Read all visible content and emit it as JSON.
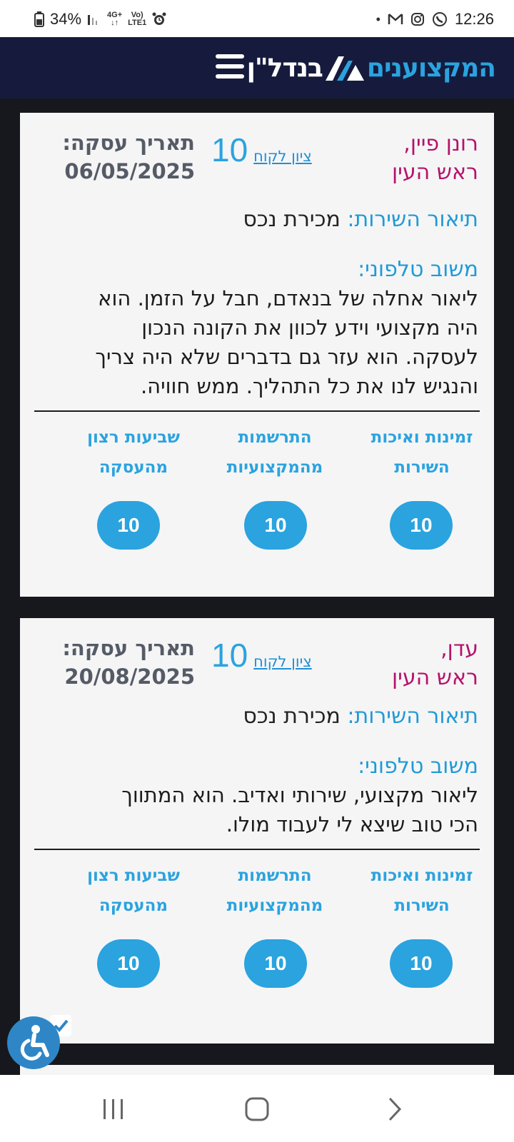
{
  "status_bar": {
    "battery": "34%",
    "network_top": "4G+",
    "volte_top": "Vo)",
    "volte_bottom": "LTE1",
    "time": "12:26"
  },
  "header": {
    "logo_word1": "המקצוענים",
    "logo_word2": "בנדל\"ן",
    "menu_icon": "hamburger-menu-icon",
    "brand_color": "#2aa3df",
    "header_bg": "#161b3d"
  },
  "common": {
    "score_label": "ציון לקוח",
    "date_label": "תאריך עסקה:",
    "service_label": "תיאור השירות:",
    "phone_label": "משוב טלפוני:",
    "cat1": "זמינות ואיכות השירות",
    "cat2": "התרשמות מהמקצועיות",
    "cat3": "שביעות רצון מהעסקה"
  },
  "reviews": [
    {
      "name_line1": "רונן פיין,",
      "name_line2": "ראש העין",
      "score": "10",
      "date": "06/05/2025",
      "service": "מכירת נכס",
      "review_lines": [
        "ליאור אחלה של בנאדם, חבל על הזמן. הוא",
        "היה מקצועי וידע לכוון את הקונה הנכון",
        "לעסקה. הוא עזר גם בדברים שלא היה צריך",
        "והנגיש לנו את כל התהליך. ממש חוויה."
      ],
      "cat1_score": "10",
      "cat2_score": "10",
      "cat3_score": "10"
    },
    {
      "name_line1": "עדן,",
      "name_line2": "ראש העין",
      "score": "10",
      "date": "20/08/2025",
      "service": "מכירת נכס",
      "review_lines": [
        "ליאור מקצועי, שירותי ואדיב. הוא המתווך",
        "הכי טוב שיצא לי לעבוד מולו."
      ],
      "cat1_score": "10",
      "cat2_score": "10",
      "cat3_score": "10"
    }
  ],
  "colors": {
    "name": "#b5126a",
    "accent": "#2aa3df",
    "card_bg": "#f5f5f6",
    "page_bg": "#17181d"
  }
}
